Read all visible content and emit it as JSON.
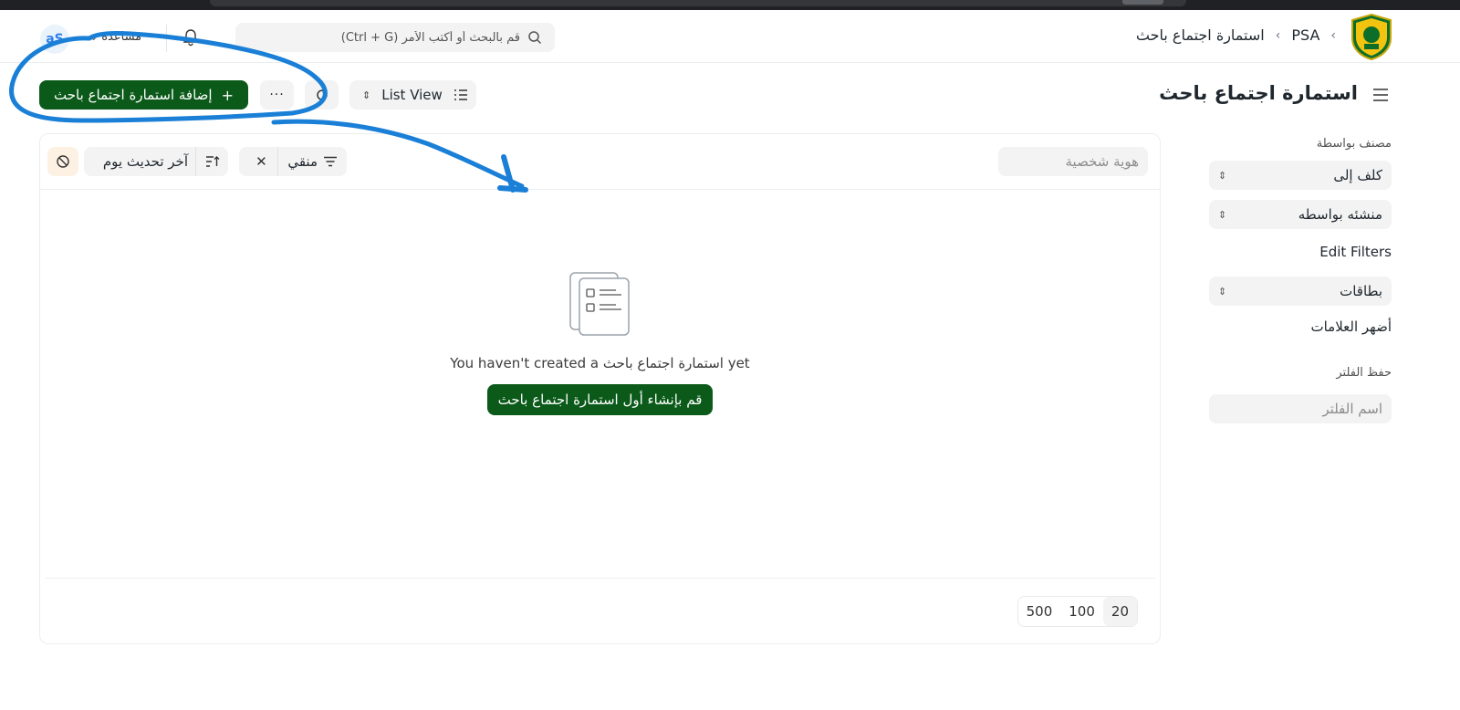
{
  "navbar": {
    "breadcrumbs": [
      "PSA",
      "استمارة اجتماع باحث"
    ],
    "search_placeholder": "قم بالبحث أو أكتب الأمر (Ctrl + G)",
    "help_label": "مساعدة",
    "avatar_initials": "aS"
  },
  "page": {
    "title": "استمارة اجتماع باحث",
    "add_button": "إضافة استمارة اجتماع باحث",
    "more_label": "···",
    "view_label": "List View"
  },
  "sidebar": {
    "classified_by_label": "مصنف بواسطة",
    "assigned_to": "كلف إلى",
    "created_by": "منشئه بواسطه",
    "edit_filters": "Edit Filters",
    "tags": "بطاقات",
    "show_tags": "أضهر العلامات",
    "save_filter_label": "حفظ الفلتر",
    "filter_name_placeholder": "اسم الفلتر"
  },
  "list": {
    "id_placeholder": "هوية شخصية",
    "filter_label": "منقي",
    "sort_label": "آخر تحديث يوم",
    "empty_message": "You haven't created a استمارة اجتماع باحث yet",
    "create_first_button": "قم بإنشاء أول استمارة اجتماع باحث",
    "page_sizes": [
      "20",
      "100",
      "500"
    ]
  },
  "colors": {
    "primary": "#0b5a1a",
    "annotation": "#1a7fd6"
  }
}
